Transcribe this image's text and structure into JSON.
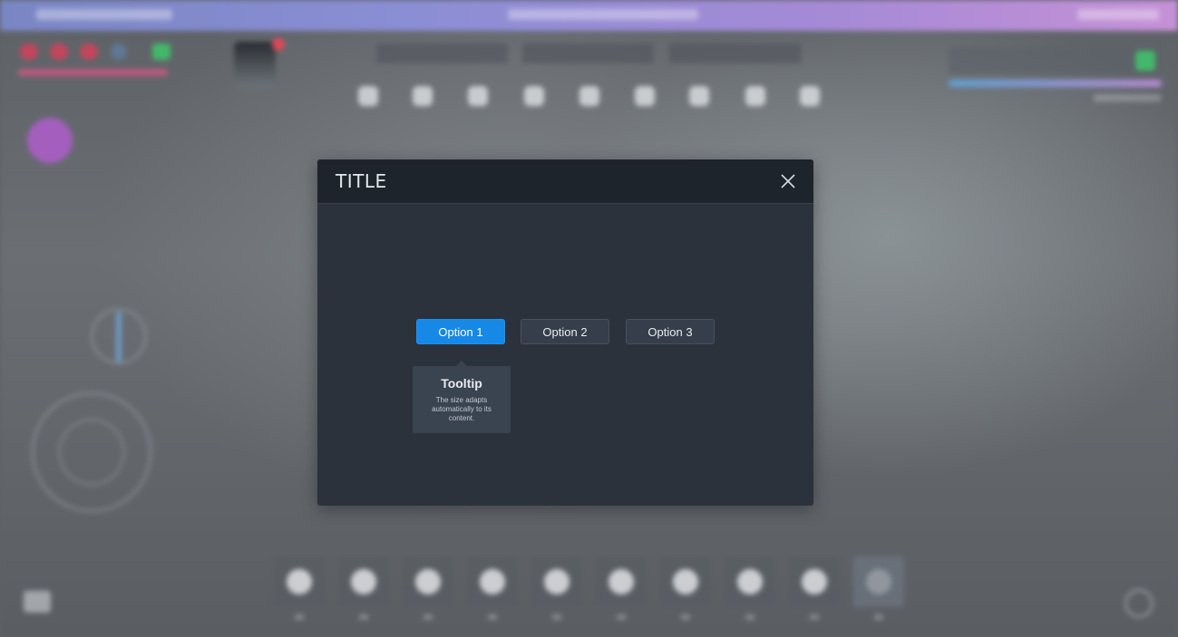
{
  "modal": {
    "title": "TITLE",
    "close_icon": "close-icon",
    "options": [
      {
        "label": "Option 1",
        "selected": true
      },
      {
        "label": "Option 2",
        "selected": false
      },
      {
        "label": "Option 3",
        "selected": false
      }
    ],
    "tooltip": {
      "title": "Tooltip",
      "body": "The size adapts automatically to its content."
    }
  },
  "colors": {
    "accent": "#1688e6",
    "modal_bg": "#2b323c",
    "header_bg": "#1e242c",
    "button_bg": "#353e4a",
    "tooltip_bg": "#3a4350",
    "banner_start": "#7a86c4",
    "banner_end": "#c591d6"
  },
  "hud": {
    "hotbar_icons": [
      "food-icon",
      "box-icon",
      "leaf-icon",
      "potion-icon",
      "skull-icon",
      "helmet-icon",
      "gem-icon",
      "stone-icon",
      "tool-icon",
      "plus-icon"
    ],
    "top_icons": [
      "armor-icon",
      "shirt-icon",
      "chest-icon",
      "gloves-icon",
      "heart-icon",
      "shield-icon",
      "mask-icon",
      "camera-icon",
      "speech-icon"
    ],
    "left_icons": [
      "map-marker-icon",
      "compass-icon",
      "joystick-icon",
      "exit-icon"
    ],
    "right_icons": [
      "settings-icon"
    ]
  }
}
